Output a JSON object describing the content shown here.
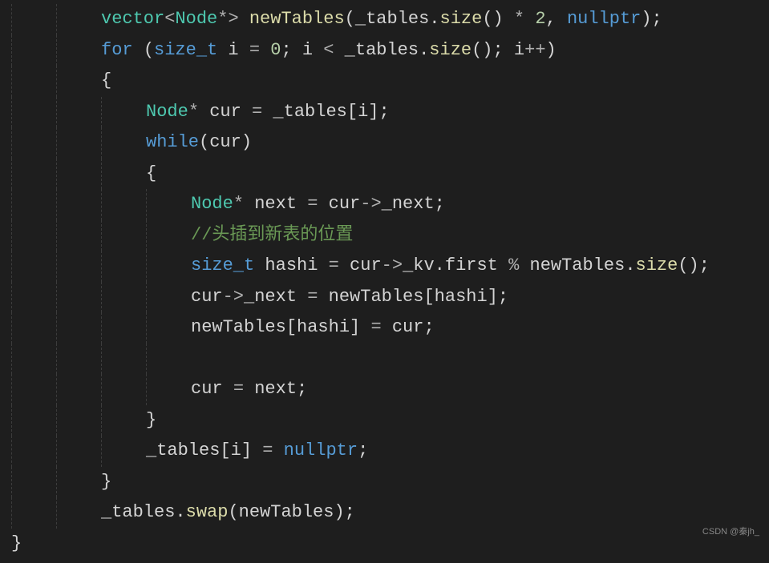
{
  "code": {
    "lines": [
      {
        "indent": 2,
        "tokens": [
          {
            "t": "type",
            "v": "vector"
          },
          {
            "t": "operator",
            "v": "<"
          },
          {
            "t": "type",
            "v": "Node"
          },
          {
            "t": "operator",
            "v": "*"
          },
          {
            "t": "operator",
            "v": ">"
          },
          {
            "t": "text",
            "v": " "
          },
          {
            "t": "method",
            "v": "newTables"
          },
          {
            "t": "punct",
            "v": "("
          },
          {
            "t": "text",
            "v": "_tables"
          },
          {
            "t": "punct",
            "v": "."
          },
          {
            "t": "method",
            "v": "size"
          },
          {
            "t": "punct",
            "v": "()"
          },
          {
            "t": "text",
            "v": " "
          },
          {
            "t": "operator",
            "v": "*"
          },
          {
            "t": "text",
            "v": " "
          },
          {
            "t": "number",
            "v": "2"
          },
          {
            "t": "punct",
            "v": ","
          },
          {
            "t": "text",
            "v": " "
          },
          {
            "t": "builtin",
            "v": "nullptr"
          },
          {
            "t": "punct",
            "v": ");"
          }
        ]
      },
      {
        "indent": 2,
        "tokens": [
          {
            "t": "keyword",
            "v": "for"
          },
          {
            "t": "text",
            "v": " "
          },
          {
            "t": "punct",
            "v": "("
          },
          {
            "t": "keyword",
            "v": "size_t"
          },
          {
            "t": "text",
            "v": " i "
          },
          {
            "t": "operator",
            "v": "="
          },
          {
            "t": "text",
            "v": " "
          },
          {
            "t": "number",
            "v": "0"
          },
          {
            "t": "punct",
            "v": ";"
          },
          {
            "t": "text",
            "v": " i "
          },
          {
            "t": "operator",
            "v": "<"
          },
          {
            "t": "text",
            "v": " _tables"
          },
          {
            "t": "punct",
            "v": "."
          },
          {
            "t": "method",
            "v": "size"
          },
          {
            "t": "punct",
            "v": "();"
          },
          {
            "t": "text",
            "v": " i"
          },
          {
            "t": "operator",
            "v": "++"
          },
          {
            "t": "punct",
            "v": ")"
          }
        ]
      },
      {
        "indent": 2,
        "tokens": [
          {
            "t": "punct",
            "v": "{"
          }
        ]
      },
      {
        "indent": 3,
        "tokens": [
          {
            "t": "type",
            "v": "Node"
          },
          {
            "t": "operator",
            "v": "*"
          },
          {
            "t": "text",
            "v": " cur "
          },
          {
            "t": "operator",
            "v": "="
          },
          {
            "t": "text",
            "v": " _tables"
          },
          {
            "t": "punct",
            "v": "["
          },
          {
            "t": "text",
            "v": "i"
          },
          {
            "t": "punct",
            "v": "];"
          }
        ]
      },
      {
        "indent": 3,
        "tokens": [
          {
            "t": "keyword",
            "v": "while"
          },
          {
            "t": "punct",
            "v": "("
          },
          {
            "t": "text",
            "v": "cur"
          },
          {
            "t": "punct",
            "v": ")"
          }
        ]
      },
      {
        "indent": 3,
        "tokens": [
          {
            "t": "punct",
            "v": "{"
          }
        ]
      },
      {
        "indent": 4,
        "tokens": [
          {
            "t": "type",
            "v": "Node"
          },
          {
            "t": "operator",
            "v": "*"
          },
          {
            "t": "text",
            "v": " next "
          },
          {
            "t": "operator",
            "v": "="
          },
          {
            "t": "text",
            "v": " cur"
          },
          {
            "t": "operator",
            "v": "->"
          },
          {
            "t": "text",
            "v": "_next"
          },
          {
            "t": "punct",
            "v": ";"
          }
        ]
      },
      {
        "indent": 4,
        "tokens": [
          {
            "t": "comment",
            "v": "//头插到新表的位置"
          }
        ]
      },
      {
        "indent": 4,
        "tokens": [
          {
            "t": "keyword",
            "v": "size_t"
          },
          {
            "t": "text",
            "v": " hashi "
          },
          {
            "t": "operator",
            "v": "="
          },
          {
            "t": "text",
            "v": " cur"
          },
          {
            "t": "operator",
            "v": "->"
          },
          {
            "t": "text",
            "v": "_kv"
          },
          {
            "t": "punct",
            "v": "."
          },
          {
            "t": "text",
            "v": "first "
          },
          {
            "t": "operator",
            "v": "%"
          },
          {
            "t": "text",
            "v": " newTables"
          },
          {
            "t": "punct",
            "v": "."
          },
          {
            "t": "method",
            "v": "size"
          },
          {
            "t": "punct",
            "v": "();"
          }
        ]
      },
      {
        "indent": 4,
        "tokens": [
          {
            "t": "text",
            "v": "cur"
          },
          {
            "t": "operator",
            "v": "->"
          },
          {
            "t": "text",
            "v": "_next "
          },
          {
            "t": "operator",
            "v": "="
          },
          {
            "t": "text",
            "v": " newTables"
          },
          {
            "t": "punct",
            "v": "["
          },
          {
            "t": "text",
            "v": "hashi"
          },
          {
            "t": "punct",
            "v": "];"
          }
        ]
      },
      {
        "indent": 4,
        "tokens": [
          {
            "t": "text",
            "v": "newTables"
          },
          {
            "t": "punct",
            "v": "["
          },
          {
            "t": "text",
            "v": "hashi"
          },
          {
            "t": "punct",
            "v": "]"
          },
          {
            "t": "text",
            "v": " "
          },
          {
            "t": "operator",
            "v": "="
          },
          {
            "t": "text",
            "v": " cur"
          },
          {
            "t": "punct",
            "v": ";"
          }
        ]
      },
      {
        "indent": 4,
        "tokens": []
      },
      {
        "indent": 4,
        "tokens": [
          {
            "t": "text",
            "v": "cur "
          },
          {
            "t": "operator",
            "v": "="
          },
          {
            "t": "text",
            "v": " next"
          },
          {
            "t": "punct",
            "v": ";"
          }
        ]
      },
      {
        "indent": 3,
        "tokens": [
          {
            "t": "punct",
            "v": "}"
          }
        ]
      },
      {
        "indent": 3,
        "tokens": [
          {
            "t": "text",
            "v": "_tables"
          },
          {
            "t": "punct",
            "v": "["
          },
          {
            "t": "text",
            "v": "i"
          },
          {
            "t": "punct",
            "v": "]"
          },
          {
            "t": "text",
            "v": " "
          },
          {
            "t": "operator",
            "v": "="
          },
          {
            "t": "text",
            "v": " "
          },
          {
            "t": "builtin",
            "v": "nullptr"
          },
          {
            "t": "punct",
            "v": ";"
          }
        ]
      },
      {
        "indent": 2,
        "tokens": [
          {
            "t": "punct",
            "v": "}"
          }
        ]
      },
      {
        "indent": 2,
        "tokens": [
          {
            "t": "text",
            "v": "_tables"
          },
          {
            "t": "punct",
            "v": "."
          },
          {
            "t": "method",
            "v": "swap"
          },
          {
            "t": "punct",
            "v": "("
          },
          {
            "t": "text",
            "v": "newTables"
          },
          {
            "t": "punct",
            "v": ");"
          }
        ]
      },
      {
        "indent": 0,
        "tokens": [
          {
            "t": "punct",
            "v": "}"
          }
        ]
      }
    ]
  },
  "watermark": "CSDN @秦jh_",
  "indent_width": 56,
  "indent_start": 14
}
